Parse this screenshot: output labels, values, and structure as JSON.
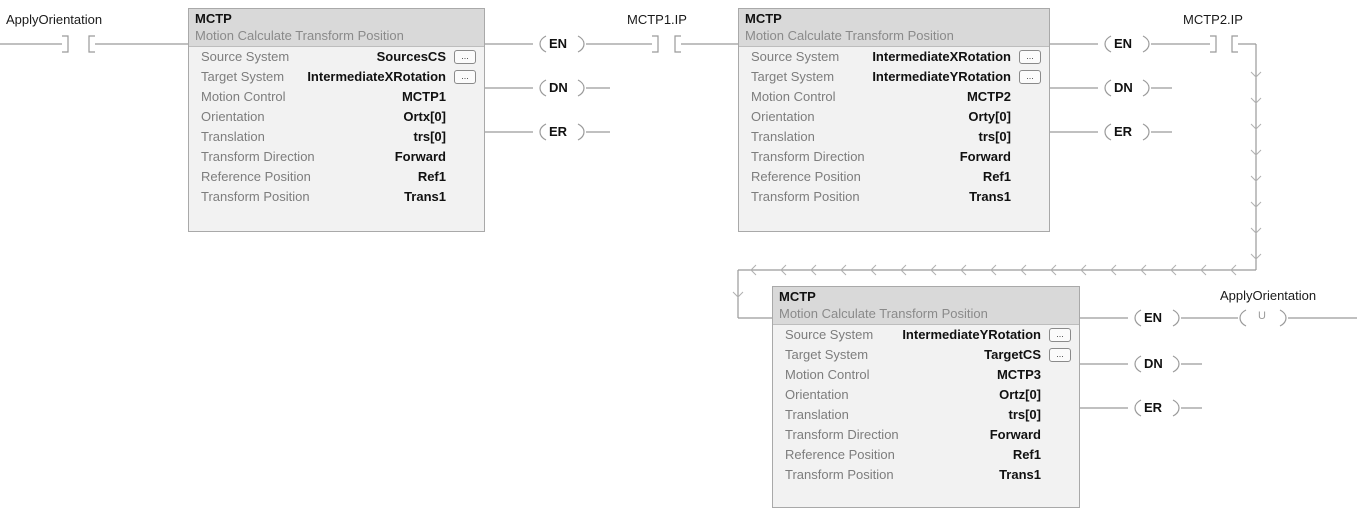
{
  "rung": {
    "input_contact": "ApplyOrientation",
    "contact_2": "MCTP1.IP",
    "contact_3": "MCTP2.IP",
    "output_coil": "ApplyOrientation",
    "output_coil_symbol": "U"
  },
  "outputs": {
    "en": "EN",
    "dn": "DN",
    "er": "ER"
  },
  "browse_label": "...",
  "blocks": [
    {
      "name": "MCTP",
      "description": "Motion Calculate Transform Position",
      "rows": [
        {
          "label": "Source System",
          "value": "SourcesCS"
        },
        {
          "label": "Target System",
          "value": "IntermediateXRotation"
        },
        {
          "label": "Motion Control",
          "value": "MCTP1"
        },
        {
          "label": "Orientation",
          "value": "Ortx[0]"
        },
        {
          "label": "Translation",
          "value": "trs[0]"
        },
        {
          "label": "Transform Direction",
          "value": "Forward"
        },
        {
          "label": "Reference Position",
          "value": "Ref1"
        },
        {
          "label": "Transform Position",
          "value": "Trans1"
        }
      ]
    },
    {
      "name": "MCTP",
      "description": "Motion Calculate Transform Position",
      "rows": [
        {
          "label": "Source System",
          "value": "IntermediateXRotation"
        },
        {
          "label": "Target System",
          "value": "IntermediateYRotation"
        },
        {
          "label": "Motion Control",
          "value": "MCTP2"
        },
        {
          "label": "Orientation",
          "value": "Orty[0]"
        },
        {
          "label": "Translation",
          "value": "trs[0]"
        },
        {
          "label": "Transform Direction",
          "value": "Forward"
        },
        {
          "label": "Reference Position",
          "value": "Ref1"
        },
        {
          "label": "Transform Position",
          "value": "Trans1"
        }
      ]
    },
    {
      "name": "MCTP",
      "description": "Motion Calculate Transform Position",
      "rows": [
        {
          "label": "Source System",
          "value": "IntermediateYRotation"
        },
        {
          "label": "Target System",
          "value": "TargetCS"
        },
        {
          "label": "Motion Control",
          "value": "MCTP3"
        },
        {
          "label": "Orientation",
          "value": "Ortz[0]"
        },
        {
          "label": "Translation",
          "value": "trs[0]"
        },
        {
          "label": "Transform Direction",
          "value": "Forward"
        },
        {
          "label": "Reference Position",
          "value": "Ref1"
        },
        {
          "label": "Transform Position",
          "value": "Trans1"
        }
      ]
    }
  ]
}
